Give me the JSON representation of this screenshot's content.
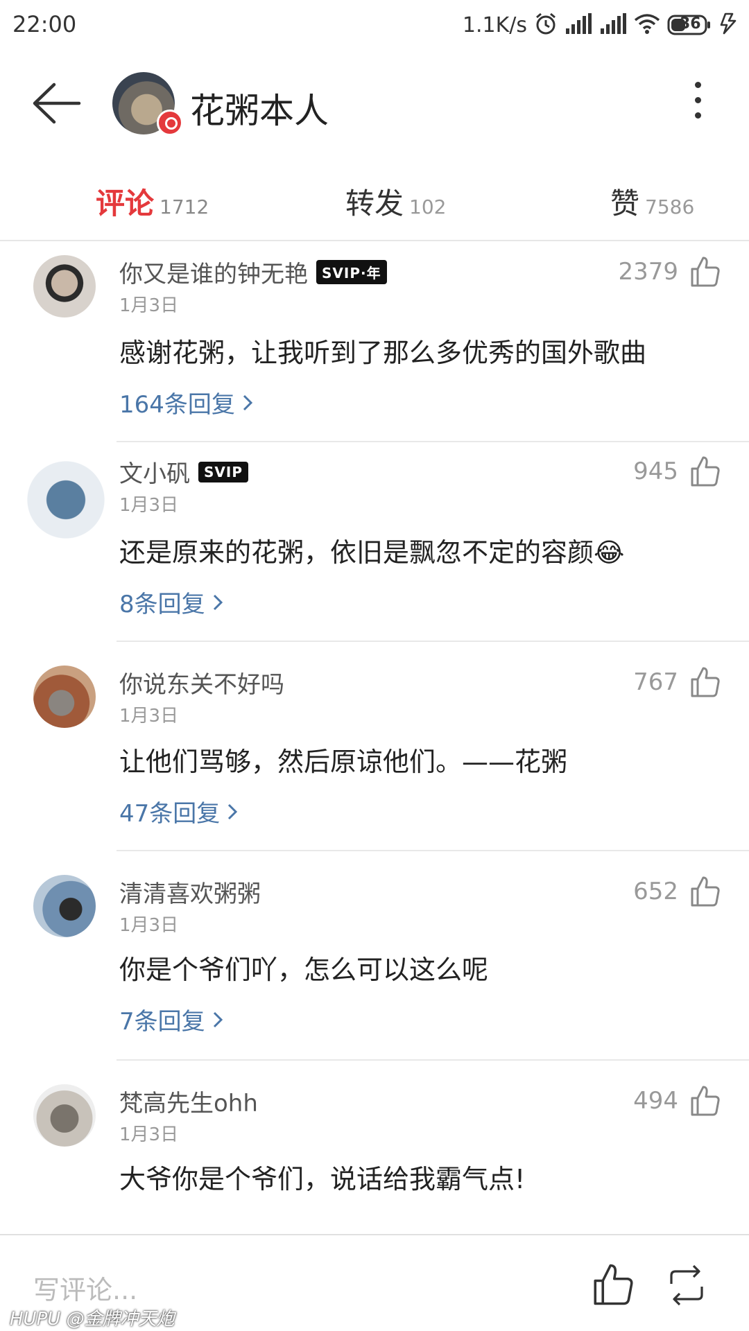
{
  "status_bar": {
    "time": "22:00",
    "network_speed": "1.1K/s",
    "battery": "36",
    "icons": [
      "alarm-icon",
      "signal-icon",
      "signal-icon",
      "wifi-icon",
      "battery-icon",
      "charging-icon"
    ]
  },
  "header": {
    "profile_name": "花粥本人",
    "icons": [
      "back-arrow-icon",
      "more-vertical-icon"
    ]
  },
  "tabs": [
    {
      "label": "评论",
      "count": "1712",
      "active": true
    },
    {
      "label": "转发",
      "count": "102",
      "active": false
    },
    {
      "label": "赞",
      "count": "7586",
      "active": false
    }
  ],
  "comments": [
    {
      "username": "你又是谁的钟无艳",
      "badge": "SVIP·年",
      "date": "1月3日",
      "likes": "2379",
      "text": "感谢花粥，让我听到了那么多优秀的国外歌曲",
      "replies": "164条回复"
    },
    {
      "username": "文小矾",
      "badge": "SVIP",
      "date": "1月3日",
      "likes": "945",
      "text": "还是原来的花粥，依旧是飘忽不定的容颜😂",
      "replies": "8条回复"
    },
    {
      "username": "你说东关不好吗",
      "badge": "",
      "date": "1月3日",
      "likes": "767",
      "text": "让他们骂够，然后原谅他们。——花粥",
      "replies": "47条回复"
    },
    {
      "username": "清清喜欢粥粥",
      "badge": "",
      "date": "1月3日",
      "likes": "652",
      "text": "你是个爷们吖，怎么可以这么呢",
      "replies": "7条回复"
    },
    {
      "username": "梵高先生ohh",
      "badge": "",
      "date": "1月3日",
      "likes": "494",
      "text": "大爷你是个爷们，说话给我霸气点!",
      "replies": ""
    }
  ],
  "bottom_bar": {
    "comment_placeholder": "写评论...",
    "icons": [
      "thumbs-up-icon",
      "repost-icon"
    ]
  },
  "watermark": "HUPU @金牌冲天炮",
  "colors": {
    "accent": "#e4393c",
    "link": "#4a76a8",
    "divider": "#e8e8e8"
  }
}
